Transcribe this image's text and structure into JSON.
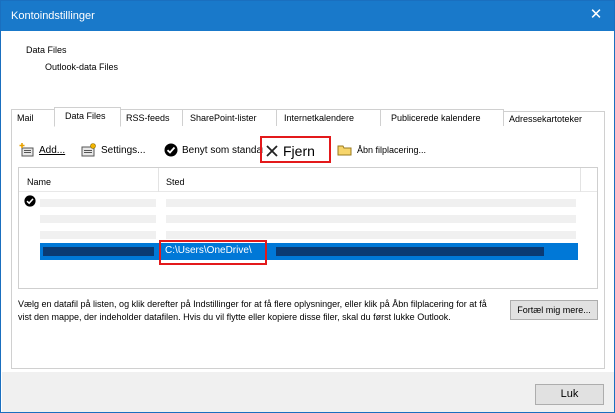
{
  "window": {
    "title": "Kontoindstillinger",
    "close_glyph": "✕"
  },
  "header": {
    "section_title": "Data Files",
    "section_subtitle": "Outlook-data Files"
  },
  "tabs": [
    {
      "label": "Mail"
    },
    {
      "label": "Data Files",
      "active": true
    },
    {
      "label": "RSS-feeds"
    },
    {
      "label": "SharePoint-lister"
    },
    {
      "label": "Internetkalendere"
    },
    {
      "label": "Publicerede kalendere"
    },
    {
      "label": "Adressekartoteker"
    }
  ],
  "toolbar": {
    "add_label": "Add...",
    "settings_label": "Settings...",
    "default_label": "Benyt som standard",
    "remove_label": "Fjern",
    "open_location_label": "Åbn filplacering..."
  },
  "list": {
    "col_name": "Name",
    "col_location": "Sted",
    "selected_path": "C:\\Users\\OneDrive\\"
  },
  "description": "Vælg en datafil på listen, og klik derefter på Indstillinger for at få flere oplysninger, eller klik på Åbn filplacering for at få vist den mappe, der indeholder datafilen. Hvis du vil flytte eller kopiere disse filer, skal du først lukke Outlook.",
  "buttons": {
    "tell_more": "Fortæl mig mere...",
    "close": "Luk"
  },
  "colors": {
    "titlebar": "#1979ca",
    "selection": "#0078d7",
    "highlight_box": "#e3191b"
  }
}
